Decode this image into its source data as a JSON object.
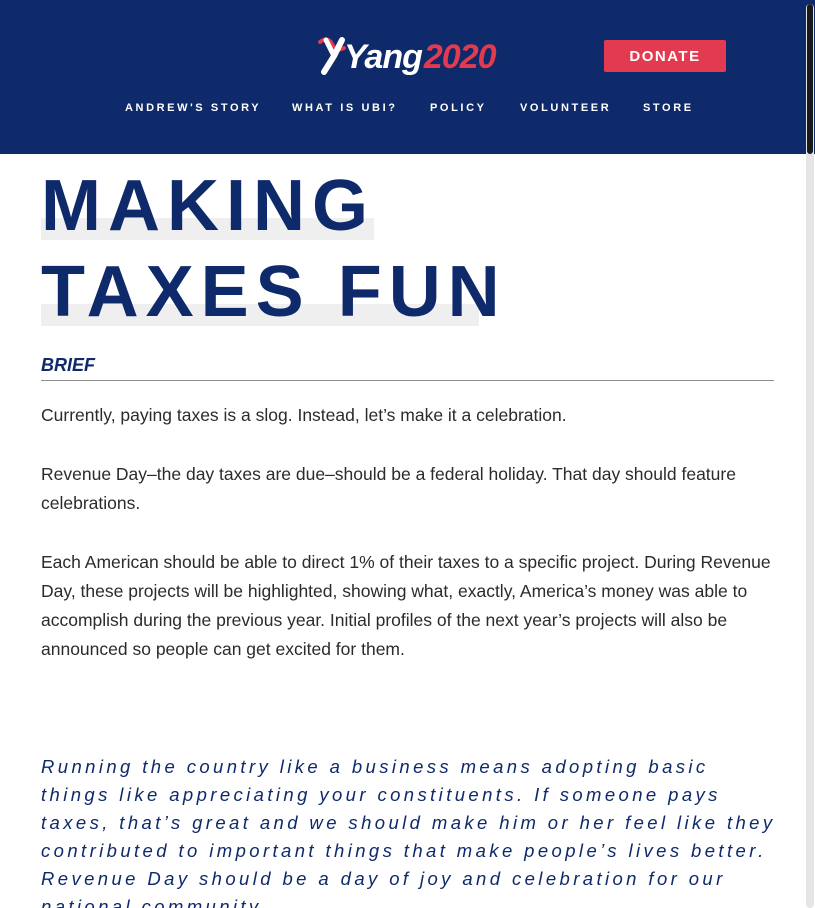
{
  "header": {
    "logo": {
      "name": "Yang",
      "year": "2020"
    },
    "donate_label": "DONATE",
    "nav": [
      {
        "label": "ANDREW'S STORY"
      },
      {
        "label": "WHAT IS UBI?"
      },
      {
        "label": "POLICY"
      },
      {
        "label": "VOLUNTEER"
      },
      {
        "label": "STORE"
      }
    ],
    "colors": {
      "background": "#0f2a6b",
      "accent": "#e23a4f"
    }
  },
  "main": {
    "title_line1": "MAKING",
    "title_line2": "TAXES FUN",
    "brief_label": "BRIEF",
    "paragraphs": [
      "Currently, paying taxes is a slog. Instead, let’s make it a celebration.",
      "Revenue Day–the day taxes are due–should be a federal holiday. That day should feature celebrations.",
      "Each American should be able to direct 1% of their taxes to a specific project. During Revenue Day, these projects will be highlighted, showing what, exactly, America’s money was able to accomplish during the previous year. Initial profiles of the next year’s projects will also be announced so people can get excited for them."
    ],
    "quote": "Running the country like a business means adopting basic things like appreciating your constituents.  If someone pays taxes, that’s great and we should make him or her feel like they contributed to important things that make people’s lives better.  Revenue Day should be a day of joy and celebration for our national community."
  }
}
